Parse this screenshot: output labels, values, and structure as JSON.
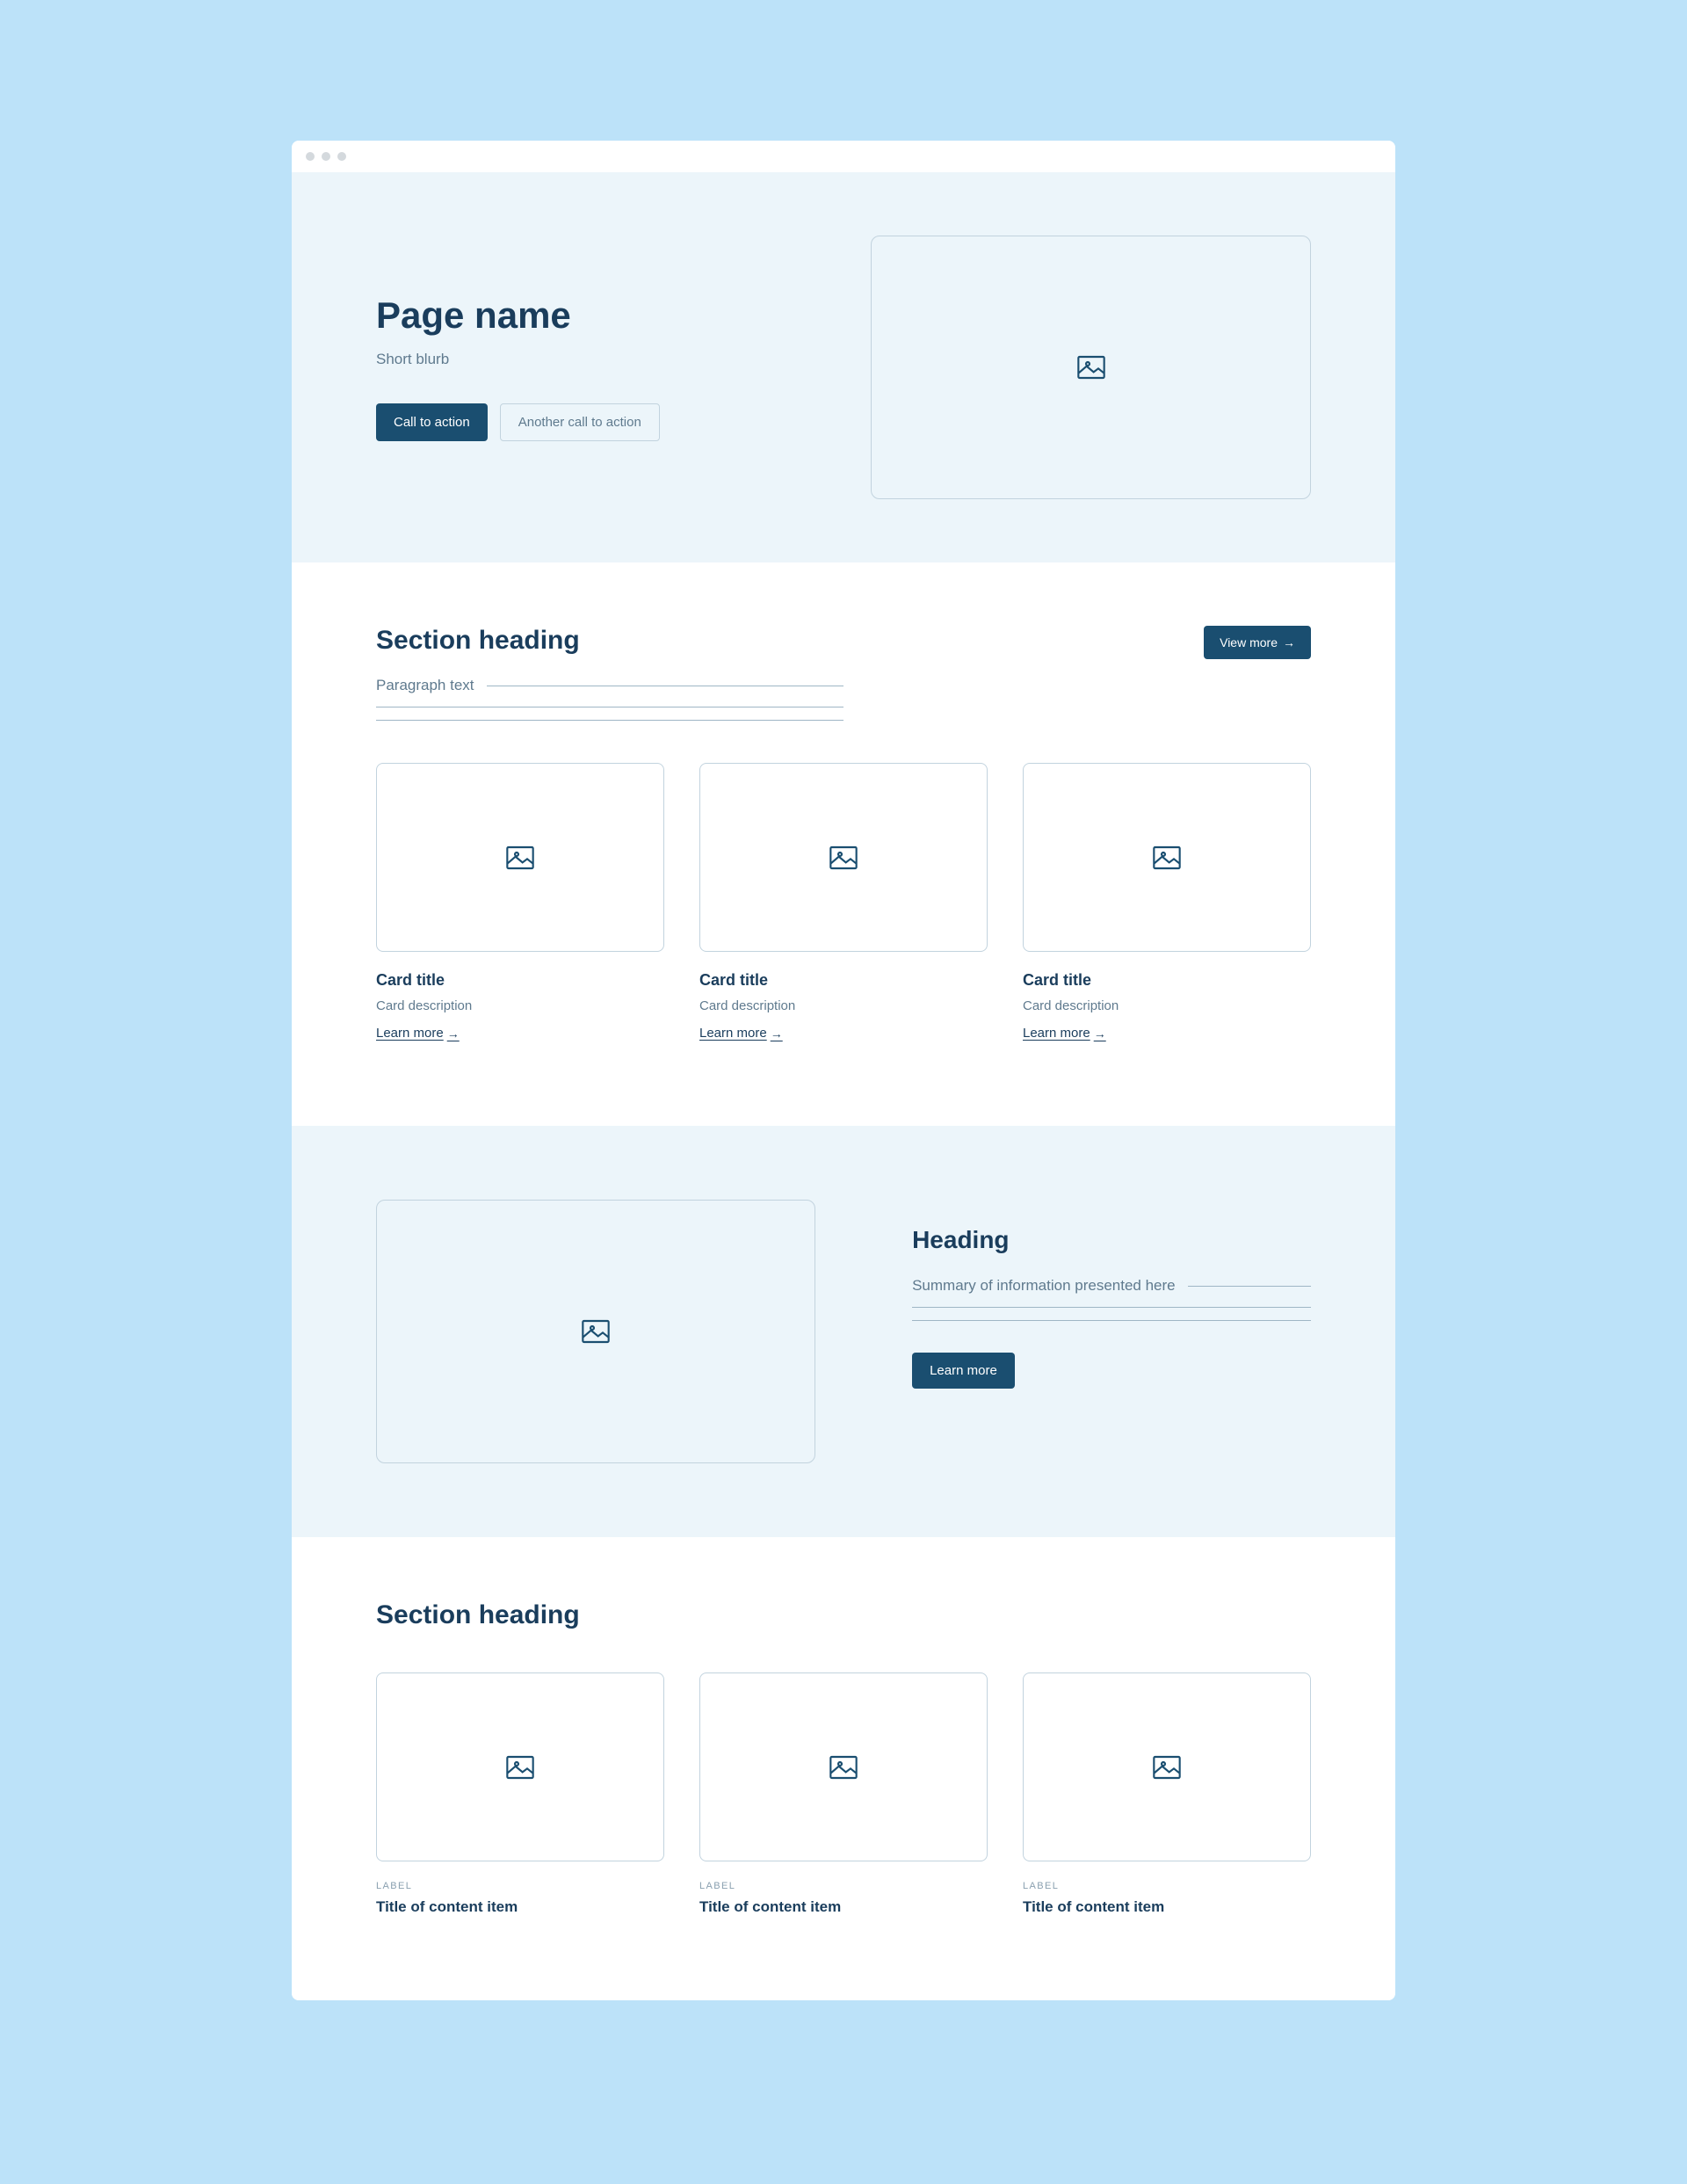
{
  "hero": {
    "title": "Page name",
    "blurb": "Short blurb",
    "cta_primary": "Call to action",
    "cta_secondary": "Another call to action"
  },
  "section1": {
    "heading": "Section heading",
    "view_more": "View more",
    "paragraph": "Paragraph text",
    "cards": [
      {
        "title": "Card title",
        "desc": "Card description",
        "link": "Learn more"
      },
      {
        "title": "Card title",
        "desc": "Card description",
        "link": "Learn more"
      },
      {
        "title": "Card title",
        "desc": "Card description",
        "link": "Learn more"
      }
    ]
  },
  "feature": {
    "heading": "Heading",
    "summary": "Summary of information presented here",
    "cta": "Learn more"
  },
  "section3": {
    "heading": "Section heading",
    "items": [
      {
        "label": "LABEL",
        "title": "Title of content item"
      },
      {
        "label": "LABEL",
        "title": "Title of content item"
      },
      {
        "label": "LABEL",
        "title": "Title of content item"
      }
    ]
  }
}
